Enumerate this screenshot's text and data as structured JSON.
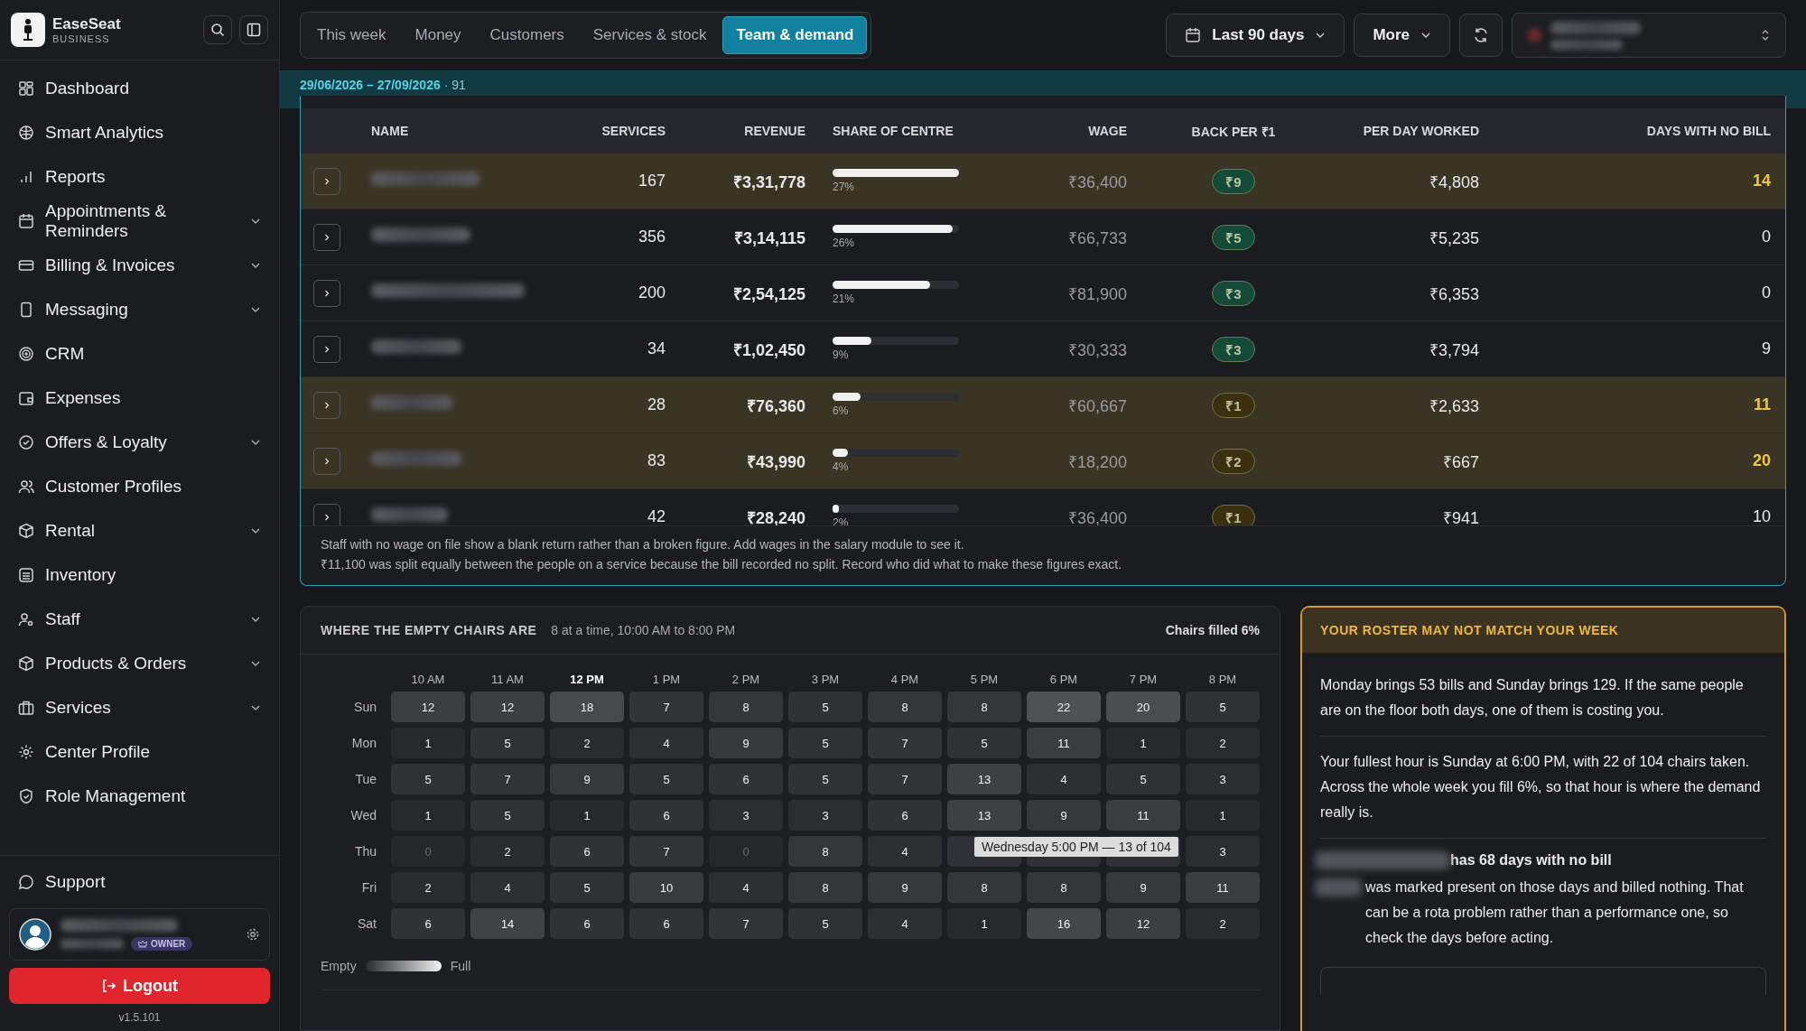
{
  "brand": {
    "name": "EaseSeat",
    "tagline": "BUSINESS"
  },
  "sidebar": {
    "items": [
      {
        "label": "Dashboard",
        "expandable": false
      },
      {
        "label": "Smart Analytics",
        "expandable": false
      },
      {
        "label": "Reports",
        "expandable": false
      },
      {
        "label": "Appointments & Reminders",
        "expandable": true
      },
      {
        "label": "Billing & Invoices",
        "expandable": true
      },
      {
        "label": "Messaging",
        "expandable": true
      },
      {
        "label": "CRM",
        "expandable": false
      },
      {
        "label": "Expenses",
        "expandable": false
      },
      {
        "label": "Offers & Loyalty",
        "expandable": true
      },
      {
        "label": "Customer Profiles",
        "expandable": false
      },
      {
        "label": "Rental",
        "expandable": true
      },
      {
        "label": "Inventory",
        "expandable": false
      },
      {
        "label": "Staff",
        "expandable": true
      },
      {
        "label": "Products & Orders",
        "expandable": true
      },
      {
        "label": "Services",
        "expandable": true
      },
      {
        "label": "Center Profile",
        "expandable": false
      },
      {
        "label": "Role Management",
        "expandable": false
      }
    ],
    "support": "Support",
    "user_role": "OWNER",
    "logout": "Logout",
    "version": "v1.5.101"
  },
  "tabs": [
    {
      "label": "This week",
      "selected": false
    },
    {
      "label": "Money",
      "selected": false
    },
    {
      "label": "Customers",
      "selected": false
    },
    {
      "label": "Services & stock",
      "selected": false
    },
    {
      "label": "Team & demand",
      "selected": true
    }
  ],
  "toolbar": {
    "range": "Last 90 days",
    "more": "More"
  },
  "date_strip": {
    "range": "29/06/2026 – 27/09/2026",
    "days": "· 91"
  },
  "table": {
    "columns": [
      "NAME",
      "SERVICES",
      "REVENUE",
      "SHARE OF CENTRE",
      "WAGE",
      "BACK PER ₹1",
      "PER DAY WORKED",
      "DAYS WITH NO BILL"
    ],
    "rows": [
      {
        "flagged": true,
        "services": "167",
        "revenue": "₹3,31,778",
        "level": 1.0,
        "share": "27%",
        "wage": "₹36,400",
        "back": "₹9",
        "color": "#134a38",
        "per_day": "₹4,808",
        "no_bill": "14"
      },
      {
        "flagged": false,
        "services": "356",
        "revenue": "₹3,14,115",
        "level": 0.95,
        "share": "26%",
        "wage": "₹66,733",
        "back": "₹5",
        "color": "#134a38",
        "per_day": "₹5,235",
        "no_bill": "0"
      },
      {
        "flagged": false,
        "services": "200",
        "revenue": "₹2,54,125",
        "level": 0.77,
        "share": "21%",
        "wage": "₹81,900",
        "back": "₹3",
        "color": "#134a38",
        "per_day": "₹6,353",
        "no_bill": "0"
      },
      {
        "flagged": false,
        "services": "34",
        "revenue": "₹1,02,450",
        "level": 0.31,
        "share": "9%",
        "wage": "₹30,333",
        "back": "₹3",
        "color": "#134a38",
        "per_day": "₹3,794",
        "no_bill": "9"
      },
      {
        "flagged": true,
        "services": "28",
        "revenue": "₹76,360",
        "level": 0.22,
        "share": "6%",
        "wage": "₹60,667",
        "back": "₹1",
        "color": "#3a3010",
        "per_day": "₹2,633",
        "no_bill": "11"
      },
      {
        "flagged": true,
        "services": "83",
        "revenue": "₹43,990",
        "level": 0.12,
        "share": "4%",
        "wage": "₹18,200",
        "back": "₹2",
        "color": "#3a3010",
        "per_day": "₹667",
        "no_bill": "20"
      },
      {
        "flagged": false,
        "services": "42",
        "revenue": "₹28,240",
        "level": 0.05,
        "share": "2%",
        "wage": "₹36,400",
        "back": "₹1",
        "color": "#3a3010",
        "per_day": "₹941",
        "no_bill": "10"
      }
    ],
    "notes": [
      "Staff with no wage on file show a blank return rather than a broken figure. Add wages in the salary module to see it.",
      "₹11,100 was split equally between the people on a service because the bill recorded no split. Record who did what to make these figures exact."
    ]
  },
  "heatmap": {
    "title": "WHERE THE EMPTY CHAIRS ARE",
    "subtitle": "8 at a time, 10:00 AM to 8:00 PM",
    "summary": "Chairs filled 6%",
    "hours": [
      {
        "label": "10 AM",
        "selected": false
      },
      {
        "label": "11 AM",
        "selected": false
      },
      {
        "label": "12 PM",
        "selected": true
      },
      {
        "label": "1 PM",
        "selected": false
      },
      {
        "label": "2 PM",
        "selected": false
      },
      {
        "label": "3 PM",
        "selected": false
      },
      {
        "label": "4 PM",
        "selected": false
      },
      {
        "label": "5 PM",
        "selected": false
      },
      {
        "label": "6 PM",
        "selected": false
      },
      {
        "label": "7 PM",
        "selected": false
      },
      {
        "label": "8 PM",
        "selected": false
      }
    ],
    "days": [
      {
        "label": "Sun",
        "cells": [
          "12",
          "12",
          "18",
          "7",
          "8",
          "5",
          "8",
          "8",
          "22",
          "20",
          "5"
        ]
      },
      {
        "label": "Mon",
        "cells": [
          "1",
          "5",
          "2",
          "4",
          "9",
          "5",
          "7",
          "5",
          "11",
          "1",
          "2"
        ]
      },
      {
        "label": "Tue",
        "cells": [
          "5",
          "7",
          "9",
          "5",
          "6",
          "5",
          "7",
          "13",
          "4",
          "5",
          "3"
        ]
      },
      {
        "label": "Wed",
        "cells": [
          "1",
          "5",
          "1",
          "6",
          "3",
          "3",
          "6",
          "13",
          "9",
          "11",
          "1"
        ]
      },
      {
        "label": "Thu",
        "cells": [
          "0",
          "2",
          "6",
          "7",
          "0",
          "8",
          "4",
          null,
          null,
          null,
          "3"
        ]
      },
      {
        "label": "Fri",
        "cells": [
          "2",
          "4",
          "5",
          "10",
          "4",
          "8",
          "9",
          "8",
          "8",
          "9",
          "11"
        ]
      },
      {
        "label": "Sat",
        "cells": [
          "6",
          "14",
          "6",
          "6",
          "7",
          "5",
          "4",
          "1",
          "16",
          "12",
          "2"
        ]
      }
    ],
    "tooltip": "Wednesday 5:00 PM — 13 of 104",
    "legend": {
      "low": "Empty",
      "high": "Full"
    }
  },
  "insight": {
    "title": "YOUR ROSTER MAY NOT MATCH YOUR WEEK",
    "paragraphs": [
      "Monday brings 53 bills and Sunday brings 129. If the same people are on the floor both days, one of them is costing you.",
      "Your fullest hour is Sunday at 6:00 PM, with 22 of 104 chairs taken. Across the whole week you fill 6%, so that hour is where the demand really is."
    ],
    "staff_heading": "has 68 days with no bill",
    "staff_text": "was marked present on those days and billed nothing. That can be a rota problem rather than a performance one, so check the days before acting."
  }
}
